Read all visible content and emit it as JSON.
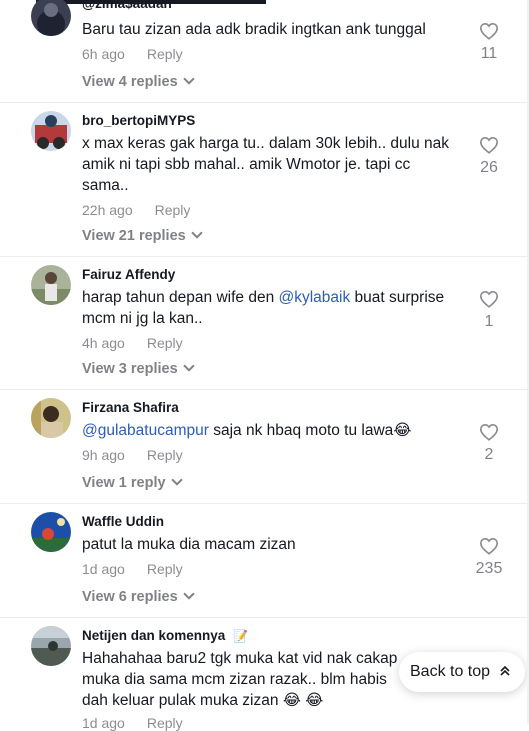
{
  "comments": [
    {
      "username": "@zima$aadah",
      "text": "Baru tau zizan ada adk bradik ingtkan ank tunggal",
      "time": "6h ago",
      "reply_label": "Reply",
      "view_replies": "View 4 replies",
      "likes": "11"
    },
    {
      "username": "bro_bertopiMYPS",
      "text": "x max keras gak harga tu.. dalam 30k lebih.. dulu nak amik ni tapi sbb mahal.. amik Wmotor je. tapi cc sama..",
      "time": "22h ago",
      "reply_label": "Reply",
      "view_replies": "View 21 replies",
      "likes": "26"
    },
    {
      "username": "Fairuz Affendy",
      "text_before": "harap tahun depan wife den ",
      "mention": "@kylabaik",
      "text_after": " buat surprise mcm ni jg la kan..",
      "time": "4h ago",
      "reply_label": "Reply",
      "view_replies": "View 3 replies",
      "likes": "1"
    },
    {
      "username": "Firzana Shafira",
      "mention": "@gulabatucampur",
      "text_after": " saja nk hbaq moto tu lawa😂",
      "time": "9h ago",
      "reply_label": "Reply",
      "view_replies": "View 1 reply",
      "likes": "2"
    },
    {
      "username": "Waffle Uddin",
      "text": "patut la muka dia macam zizan",
      "time": "1d ago",
      "reply_label": "Reply",
      "view_replies": "View 6 replies",
      "likes": "235"
    },
    {
      "username": "Netijen dan komennya",
      "username_emoji": "📝",
      "text_line1": "Hahahahaa baru2 tgk muka kat vid nak cakap",
      "text_line2": "muka dia sama mcm zizan razak.. blm habis",
      "text_line3": "dah keluar pulak muka zizan 😂 😂",
      "time": "1d ago",
      "reply_label": "Reply"
    }
  ],
  "back_to_top": {
    "label": "Back to top",
    "icon": "double-chevron-up-icon"
  },
  "colors": {
    "text": "#161823",
    "muted": "#8a8b91",
    "mention": "#2b5db9"
  }
}
